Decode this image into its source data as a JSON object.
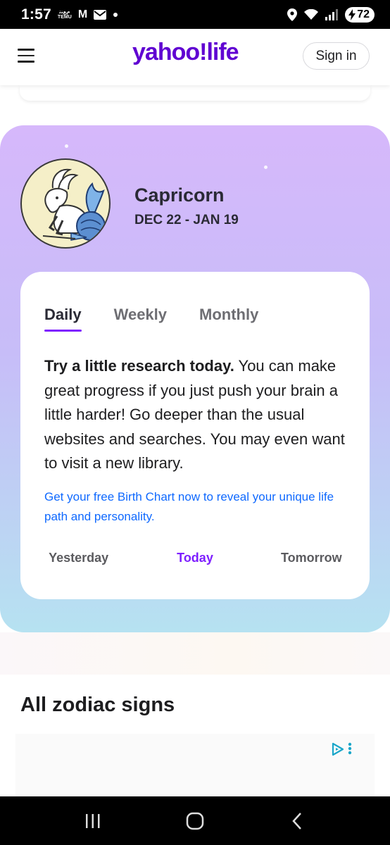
{
  "status_bar": {
    "time": "1:57",
    "temu_top": "ﻡﻊﻨﺗ",
    "temu_bottom": "TEMU",
    "gmail_glyph": "M",
    "battery": "72"
  },
  "header": {
    "brand": "yahoo!life",
    "signin_label": "Sign in"
  },
  "horoscope": {
    "sign": "Capricorn",
    "dates": "DEC 22 - JAN 19",
    "tabs": [
      {
        "label": "Daily",
        "active": true
      },
      {
        "label": "Weekly",
        "active": false
      },
      {
        "label": "Monthly",
        "active": false
      }
    ],
    "reading_lead": "Try a little research today.",
    "reading_body": " You can make great progress if you just push your brain a little harder! Go deeper than the usual websites and searches. You may even want to visit a new library.",
    "birth_chart_link": "Get your free Birth Chart now to reveal your unique life path and personality.",
    "day_nav": [
      {
        "label": "Yesterday",
        "active": false
      },
      {
        "label": "Today",
        "active": true
      },
      {
        "label": "Tomorrow",
        "active": false
      }
    ]
  },
  "section": {
    "title": "All zodiac signs"
  },
  "colors": {
    "brand": "#6001d2",
    "accent": "#7e1fff",
    "link": "#0f69ff"
  }
}
